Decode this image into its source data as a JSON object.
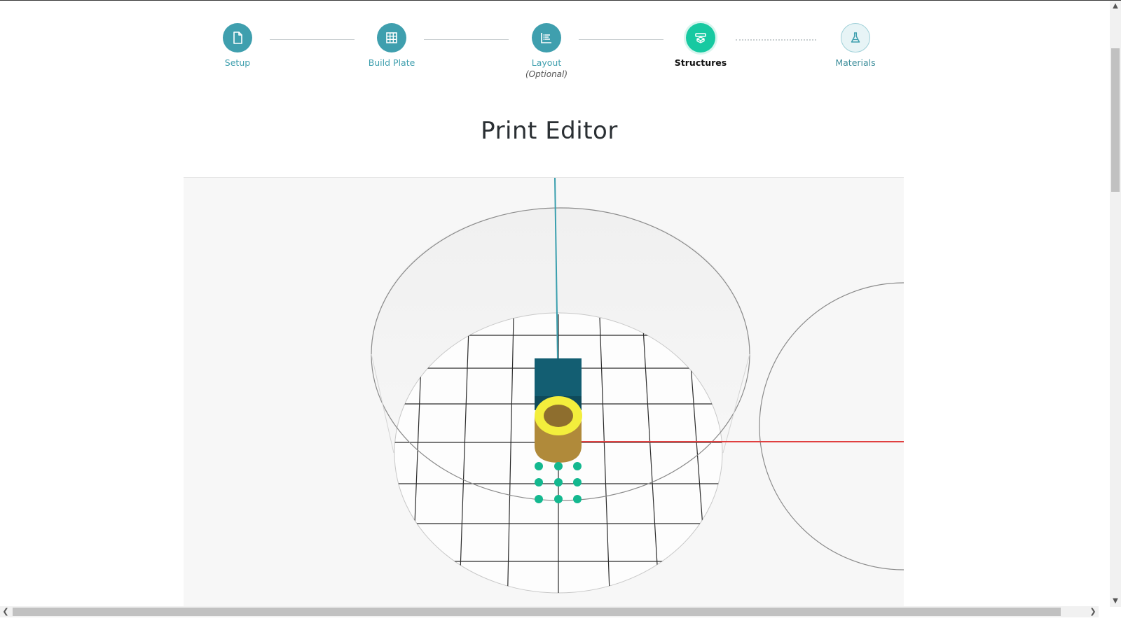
{
  "stepper": {
    "steps": [
      {
        "label": "Setup",
        "sub": "",
        "state": "done",
        "icon": "document-icon"
      },
      {
        "label": "Build Plate",
        "sub": "",
        "state": "done",
        "icon": "grid-icon"
      },
      {
        "label": "Layout",
        "sub": "(Optional)",
        "state": "done",
        "icon": "layout-icon"
      },
      {
        "label": "Structures",
        "sub": "",
        "state": "active",
        "icon": "structures-icon"
      },
      {
        "label": "Materials",
        "sub": "",
        "state": "upcoming",
        "icon": "flask-icon"
      }
    ]
  },
  "page": {
    "title": "Print Editor"
  },
  "colors": {
    "step_done": "#3f9fae",
    "step_active": "#17c9a1",
    "axis_y": "#3a9fae",
    "axis_x": "#e04040",
    "model_box": "#135e72",
    "model_cylinder": "#b08a3a",
    "model_ring": "#f3ee3c",
    "well_dots": "#14b88f"
  }
}
